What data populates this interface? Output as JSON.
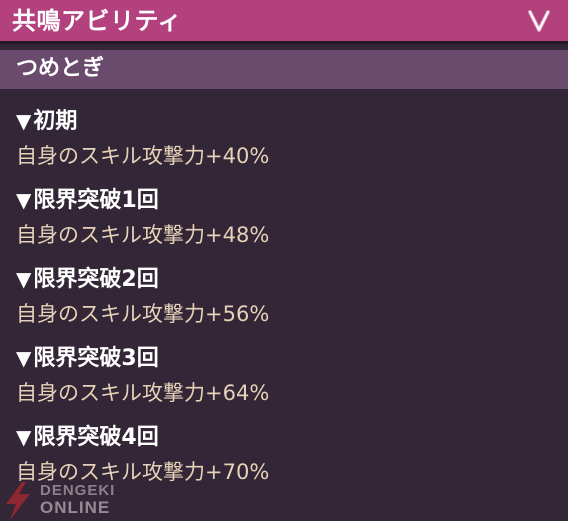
{
  "header": {
    "title": "共鳴アビリティ",
    "collapse_icon": "chevron-down-icon"
  },
  "ability": {
    "name": "つめとぎ"
  },
  "levels": [
    {
      "marker": "▼",
      "label": "初期",
      "effect": "自身のスキル攻撃力+40%"
    },
    {
      "marker": "▼",
      "label": "限界突破1回",
      "effect": "自身のスキル攻撃力+48%"
    },
    {
      "marker": "▼",
      "label": "限界突破2回",
      "effect": "自身のスキル攻撃力+56%"
    },
    {
      "marker": "▼",
      "label": "限界突破3回",
      "effect": "自身のスキル攻撃力+64%"
    },
    {
      "marker": "▼",
      "label": "限界突破4回",
      "effect": "自身のスキル攻撃力+70%"
    }
  ],
  "watermark": {
    "line1": "DENGEKI",
    "line2": "ONLINE"
  },
  "colors": {
    "header_bg": "#b2417e",
    "subheader_bg": "#6a4a6d",
    "panel_bg": "#332636",
    "heading_text": "#ffffff",
    "effect_text": "#e6d2b8",
    "watermark_red": "#d7282f"
  }
}
